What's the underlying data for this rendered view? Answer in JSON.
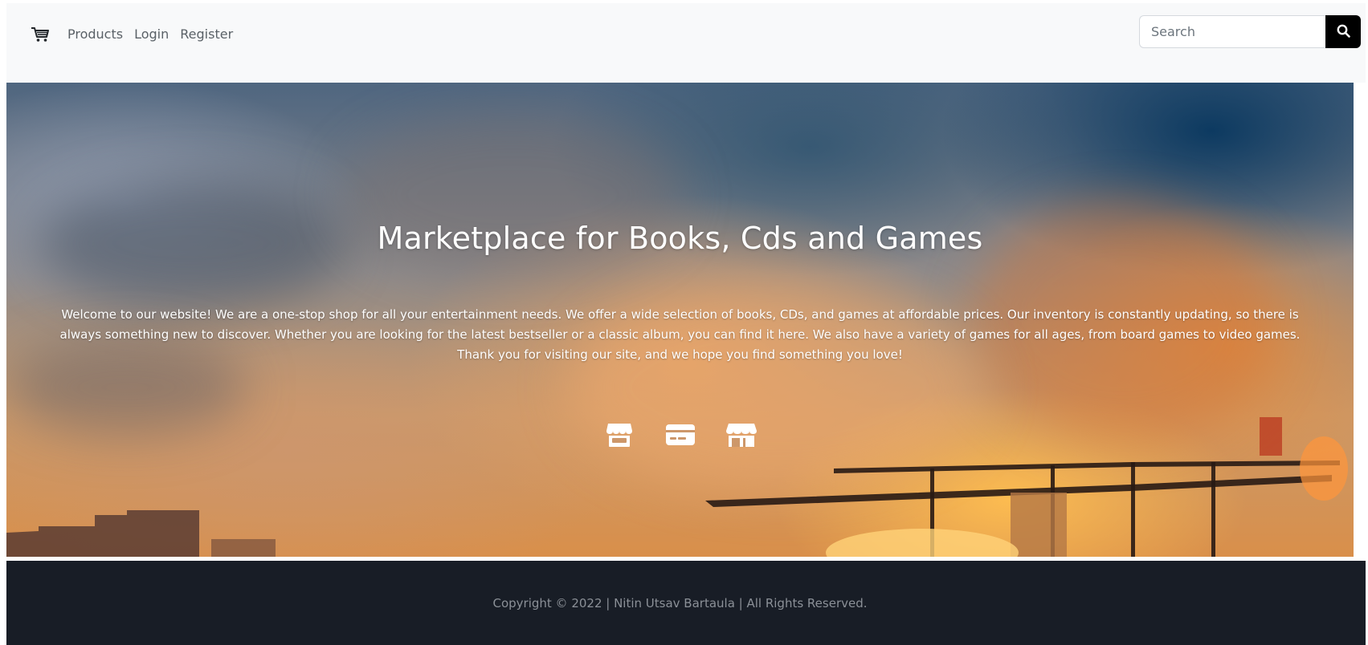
{
  "navbar": {
    "cart_icon": "cart-icon",
    "links": [
      "Products",
      "Login",
      "Register"
    ],
    "search": {
      "placeholder": "Search",
      "value": "",
      "button_icon": "search-icon"
    }
  },
  "hero": {
    "title": "Marketplace for Books, Cds and Games",
    "description": "Welcome to our website! We are a one-stop shop for all your entertainment needs. We offer a wide selection of books, CDs, and games at affordable prices. Our inventory is constantly updating, so there is always something new to discover. Whether you are looking for the latest bestseller or a classic album, you can find it here. We also have a variety of games for all ages, from board games to video games. Thank you for visiting our site, and we hope you find something you love!",
    "icons": [
      "store-icon",
      "credit-card-icon",
      "shop-icon"
    ]
  },
  "footer": {
    "copyright": "Copyright © 2022 | Nitin Utsav Bartaula | All Rights Reserved."
  },
  "colors": {
    "navbar_bg": "#f8f9fa",
    "search_button_bg": "#000000",
    "footer_bg": "#181d26",
    "footer_text": "#8b9097",
    "hero_text": "#ffffff"
  }
}
